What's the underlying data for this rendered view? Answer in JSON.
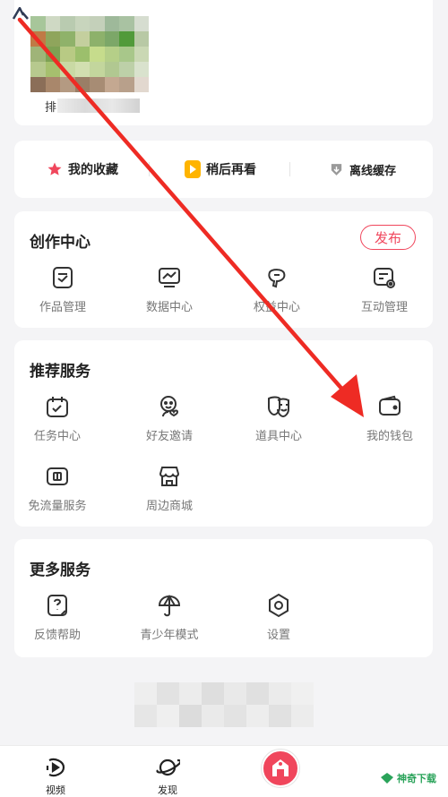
{
  "profile": {
    "name_prefix": "排"
  },
  "quick_actions": [
    {
      "label": "我的收藏",
      "icon": "star-icon",
      "color": "#f0465c"
    },
    {
      "label": "稍后再看",
      "icon": "play-icon",
      "color": "#ffb400"
    },
    {
      "label": "离线缓存",
      "icon": "download-icon",
      "color": "#9a9a9a"
    }
  ],
  "creation_center": {
    "title": "创作中心",
    "publish_label": "发布",
    "items": [
      {
        "label": "作品管理",
        "icon": "works-icon"
      },
      {
        "label": "数据中心",
        "icon": "data-chart-icon"
      },
      {
        "label": "权益中心",
        "icon": "rights-icon"
      },
      {
        "label": "互动管理",
        "icon": "interaction-icon"
      }
    ]
  },
  "recommended_services": {
    "title": "推荐服务",
    "items": [
      {
        "label": "任务中心",
        "icon": "task-icon"
      },
      {
        "label": "好友邀请",
        "icon": "invite-friend-icon"
      },
      {
        "label": "道具中心",
        "icon": "mask-icon"
      },
      {
        "label": "我的钱包",
        "icon": "wallet-icon"
      },
      {
        "label": "免流量服务",
        "icon": "sim-card-icon"
      },
      {
        "label": "周边商城",
        "icon": "store-icon"
      }
    ]
  },
  "more_services": {
    "title": "更多服务",
    "items": [
      {
        "label": "反馈帮助",
        "icon": "feedback-icon"
      },
      {
        "label": "青少年模式",
        "icon": "umbrella-icon"
      },
      {
        "label": "设置",
        "icon": "settings-icon"
      }
    ]
  },
  "bottom_nav": [
    {
      "label": "视频",
      "icon": "video-icon"
    },
    {
      "label": "发现",
      "icon": "planet-icon"
    },
    {
      "label": "",
      "icon": "avatar-icon"
    }
  ],
  "watermark": {
    "text": "神奇下载"
  },
  "colors": {
    "accent": "#f0465c",
    "annotation_arrow": "#ee2b24",
    "background": "#f4f4f6",
    "label_gray": "#777777"
  }
}
